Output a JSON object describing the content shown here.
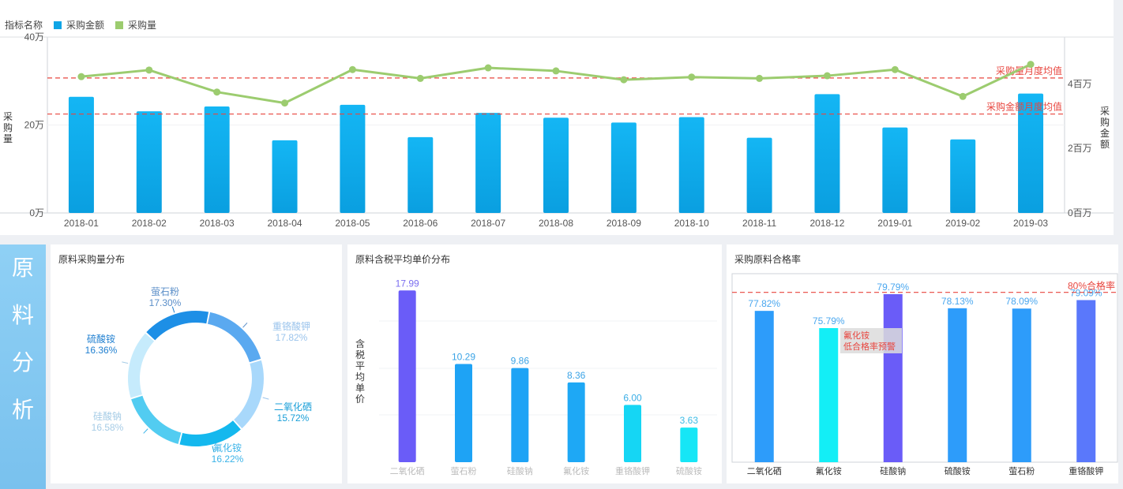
{
  "top_chart": {
    "legend_title": "指标名称",
    "legend_items": [
      {
        "label": "采购金额",
        "color": "#0fa5e6"
      },
      {
        "label": "采购量",
        "color": "#9ccc6f"
      }
    ],
    "left_axis_label": "采购量",
    "right_axis_label": "采购金额",
    "ref_line_volume_label": "采购量月度均值",
    "ref_line_amount_label": "采购金额月度均值"
  },
  "side_label": {
    "chars": [
      "原",
      "料",
      "分",
      "析"
    ]
  },
  "panels": {
    "distribution_title": "原料采购量分布",
    "price_title": "原料含税平均单价分布",
    "rate_title": "采购原料合格率"
  },
  "chart_data": [
    {
      "type": "bar",
      "categories": [
        "2018-01",
        "2018-02",
        "2018-03",
        "2018-04",
        "2018-05",
        "2018-06",
        "2018-07",
        "2018-08",
        "2018-09",
        "2018-10",
        "2018-11",
        "2018-12",
        "2019-01",
        "2019-02",
        "2019-03"
      ],
      "series": [
        {
          "name": "采购金额",
          "type": "bar",
          "axis": "right",
          "color": "#0fa5e6",
          "values": [
            3.6,
            3.15,
            3.3,
            2.25,
            3.35,
            2.35,
            3.1,
            2.95,
            2.8,
            2.97,
            2.33,
            3.68,
            2.65,
            2.28,
            3.7
          ]
        },
        {
          "name": "采购量",
          "type": "line",
          "axis": "left",
          "color": "#9ccc6f",
          "values": [
            31.0,
            32.5,
            27.5,
            25.0,
            32.6,
            30.6,
            33.0,
            32.3,
            30.3,
            30.9,
            30.6,
            31.2,
            32.6,
            26.5,
            33.8
          ]
        }
      ],
      "left_axis": {
        "ticks": [
          "0万",
          "20万",
          "40万"
        ],
        "range": [
          0,
          40
        ]
      },
      "right_axis": {
        "ticks": [
          "0百万",
          "2百万",
          "4百万"
        ],
        "range": [
          0,
          5.45
        ]
      },
      "reference_lines": [
        {
          "label": "采购量月度均值",
          "axis": "left",
          "value": 30.7
        },
        {
          "label": "采购金额月度均值",
          "axis": "left",
          "value": 22.5
        }
      ],
      "grid": true,
      "legend_position": "top-left"
    },
    {
      "type": "pie",
      "donut": true,
      "slices": [
        {
          "label": "萤石粉",
          "value": 17.3,
          "display": "17.30%",
          "color": "#5aa9f0",
          "text_color": "#5a8ec8"
        },
        {
          "label": "重铬酸钾",
          "value": 17.82,
          "display": "17.82%",
          "color": "#a8d8fb",
          "text_color": "#9bc4ec"
        },
        {
          "label": "二氧化硒",
          "value": 15.72,
          "display": "15.72%",
          "color": "#14b8ee",
          "text_color": "#1a9fd8"
        },
        {
          "label": "氟化铵",
          "value": 16.22,
          "display": "16.22%",
          "color": "#52ccf1",
          "text_color": "#3ab3e8"
        },
        {
          "label": "硅酸钠",
          "value": 16.58,
          "display": "16.58%",
          "color": "#c6ebfc",
          "text_color": "#a6cce6"
        },
        {
          "label": "硫酸铵",
          "value": 16.36,
          "display": "16.36%",
          "color": "#1d8fe6",
          "text_color": "#1f7fd0"
        }
      ],
      "legend_position": "none"
    },
    {
      "type": "bar",
      "categories": [
        "二氧化硒",
        "萤石粉",
        "硅酸钠",
        "氟化铵",
        "重铬酸钾",
        "硫酸铵"
      ],
      "values": [
        17.99,
        10.29,
        9.86,
        8.36,
        6.0,
        3.63
      ],
      "labels": [
        "17.99",
        "10.29",
        "9.86",
        "8.36",
        "6.00",
        "3.63"
      ],
      "ylabel": "含税平均单价",
      "ylim": [
        0,
        19.5
      ],
      "colors": [
        "#6a5cf8",
        "#1ea3f5",
        "#1ea3f5",
        "#1ea8f5",
        "#15d6f4",
        "#16e6f6"
      ],
      "label_colors": [
        "#7b6ef0",
        "#3aa3e6",
        "#3aa3e6",
        "#3aa3e6",
        "#3aaee6",
        "#3abbe6"
      ],
      "grid": true
    },
    {
      "type": "bar",
      "categories": [
        "二氧化硒",
        "氟化铵",
        "硅酸钠",
        "硫酸铵",
        "萤石粉",
        "重铬酸钾"
      ],
      "values": [
        77.82,
        75.79,
        79.79,
        78.13,
        78.09,
        79.09
      ],
      "labels": [
        "77.82%",
        "75.79%",
        "79.79%",
        "78.13%",
        "78.09%",
        "79.09%"
      ],
      "ylim": [
        60,
        82.2
      ],
      "colors": [
        "#2d9cfa",
        "#13eef6",
        "#6a5cf8",
        "#2d9cfa",
        "#2d9cfa",
        "#5a78fb"
      ],
      "reference_lines": [
        {
          "label": "80%合格率",
          "value": 80
        }
      ],
      "annotation": {
        "lines": [
          "氟化铵",
          "低合格率预警"
        ]
      },
      "grid": false
    }
  ]
}
